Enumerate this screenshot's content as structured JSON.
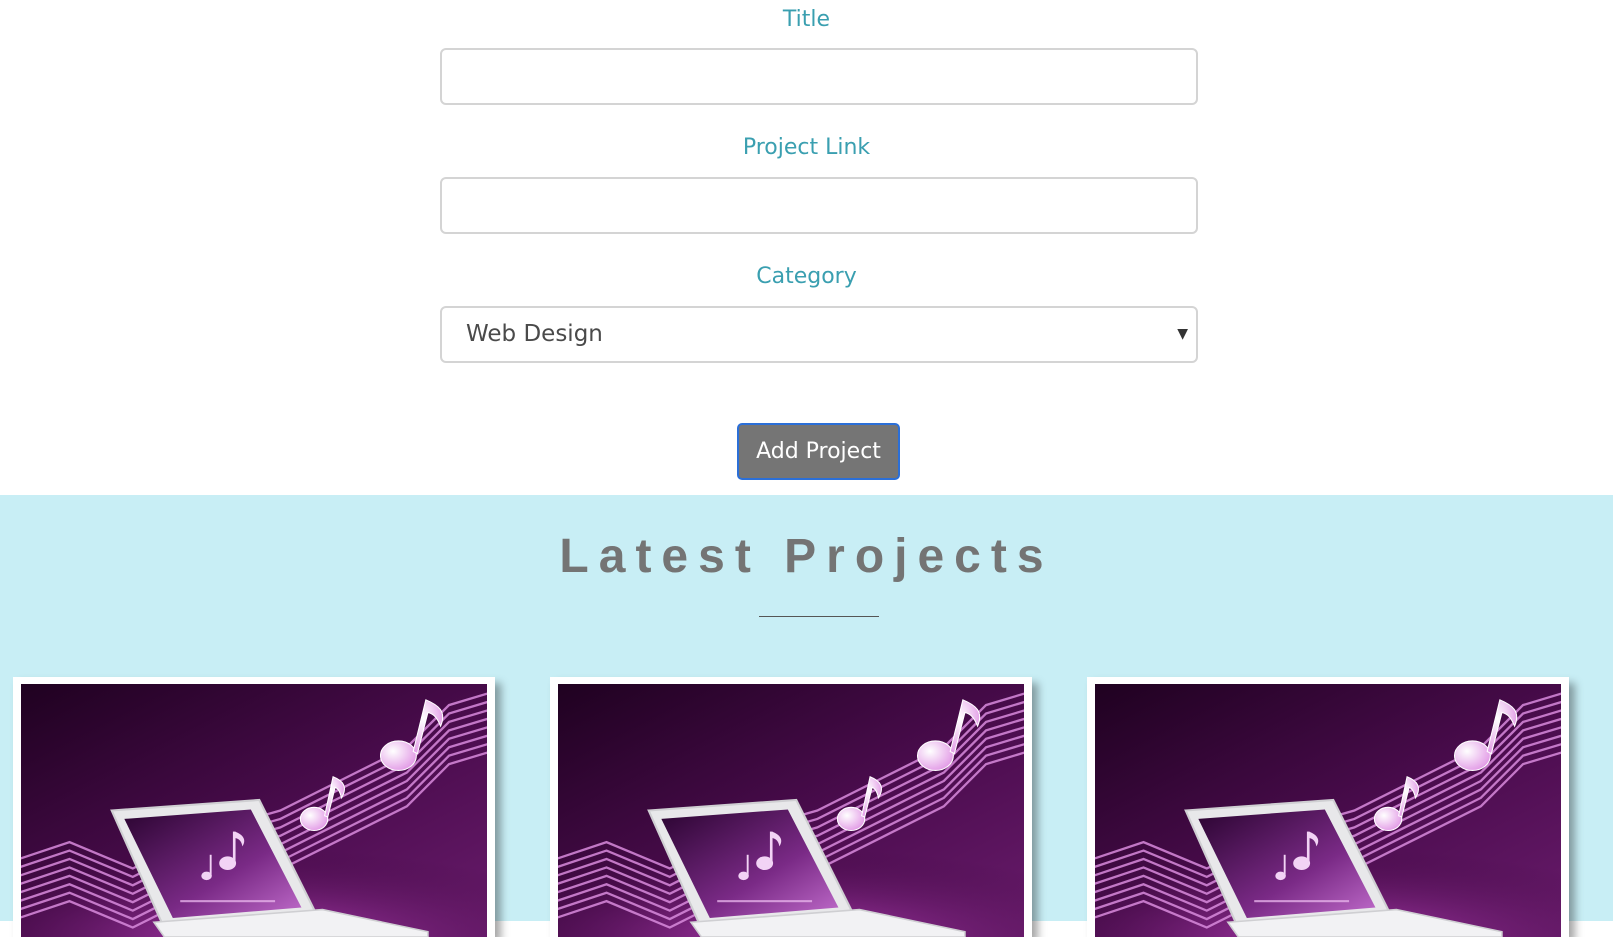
{
  "form": {
    "title_label": "Title",
    "title_value": "",
    "link_label": "Project Link",
    "link_value": "",
    "category_label": "Category",
    "category_selected": "Web Design",
    "submit_label": "Add Project"
  },
  "projects": {
    "heading": "Latest Projects",
    "cards": [
      {
        "image": "laptop-music-notes-illustration"
      },
      {
        "image": "laptop-music-notes-illustration"
      },
      {
        "image": "laptop-music-notes-illustration"
      }
    ]
  },
  "colors": {
    "label": "#3a9fb0",
    "button_bg": "#757575",
    "button_border": "#2b6fd8",
    "section_bg": "#c8eef5",
    "heading": "#747474",
    "image_purple": "#4a0a4a"
  }
}
